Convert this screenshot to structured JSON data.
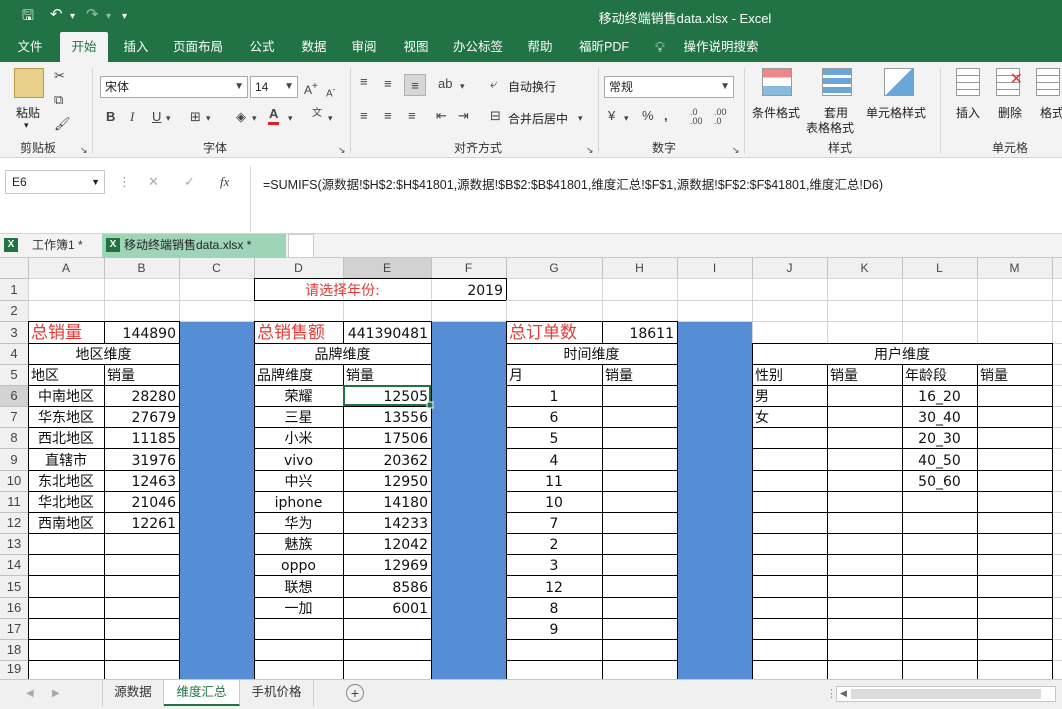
{
  "window": {
    "title": "移动终端销售data.xlsx  -  Excel"
  },
  "menu": [
    "文件",
    "开始",
    "插入",
    "页面布局",
    "公式",
    "数据",
    "审阅",
    "视图",
    "办公标签",
    "帮助",
    "福昕PDF",
    "操作说明搜索"
  ],
  "ribbon": {
    "paste": "粘贴",
    "clipboard": "剪贴板",
    "font_name": "宋体",
    "font_size": "14",
    "font_group": "字体",
    "wrap": "自动换行",
    "merge": "合并后居中",
    "align_group": "对齐方式",
    "num_format": "常规",
    "num_group": "数字",
    "cond_format": "条件格式",
    "table_format_1": "套用",
    "table_format_2": "表格格式",
    "cell_style": "单元格样式",
    "style_group": "样式",
    "insert": "插入",
    "delete": "删除",
    "format": "格式",
    "cells_group": "单元格"
  },
  "formula_bar": {
    "name_box": "E6",
    "formula": "=SUMIFS(源数据!$H$2:$H$41801,源数据!$B$2:$B$41801,维度汇总!$F$1,源数据!$F$2:$F$41801,维度汇总!D6)"
  },
  "workbook_tabs": [
    "工作簿1 *",
    "移动终端销售data.xlsx *"
  ],
  "columns": [
    "A",
    "B",
    "C",
    "D",
    "E",
    "F",
    "G",
    "H",
    "I",
    "J",
    "K",
    "L",
    "M"
  ],
  "cells": {
    "D1": "请选择年份:",
    "F1": "2019",
    "A3": "总销量",
    "B3": "144890",
    "D3": "总销售额",
    "E3": "441390481",
    "G3": "总订单数",
    "H3": "18611",
    "A4": "地区维度",
    "D4": "品牌维度",
    "G4": "时间维度",
    "J4": "用户维度",
    "A5": "地区",
    "B5": "销量",
    "D5": "品牌维度",
    "E5": "销量",
    "G5": "月",
    "H5": "销量",
    "J5": "性别",
    "K5": "销量",
    "L5": "年龄段",
    "M5": "销量",
    "A6": "中南地区",
    "B6": "28280",
    "D6": "荣耀",
    "E6": "12505",
    "G6": "1",
    "J6": "男",
    "L6": "16_20",
    "A7": "华东地区",
    "B7": "27679",
    "D7": "三星",
    "E7": "13556",
    "G7": "6",
    "J7": "女",
    "L7": "30_40",
    "A8": "西北地区",
    "B8": "11185",
    "D8": "小米",
    "E8": "17506",
    "G8": "5",
    "L8": "20_30",
    "A9": "直辖市",
    "B9": "31976",
    "D9": "vivo",
    "E9": "20362",
    "G9": "4",
    "L9": "40_50",
    "A10": "东北地区",
    "B10": "12463",
    "D10": "中兴",
    "E10": "12950",
    "G10": "11",
    "L10": "50_60",
    "A11": "华北地区",
    "B11": "21046",
    "D11": "iphone",
    "E11": "14180",
    "G11": "10",
    "A12": "西南地区",
    "B12": "12261",
    "D12": "华为",
    "E12": "14233",
    "G12": "7",
    "D13": "魅族",
    "E13": "12042",
    "G13": "2",
    "D14": "oppo",
    "E14": "12969",
    "G14": "3",
    "D15": "联想",
    "E15": "8586",
    "G15": "12",
    "D16": "一加",
    "E16": "6001",
    "G16": "8",
    "G17": "9"
  },
  "sheet_tabs": [
    "源数据",
    "维度汇总",
    "手机价格"
  ],
  "colors": {
    "accent": "#217346",
    "blue_fill": "#558ed5",
    "red_text": "#e53935"
  }
}
